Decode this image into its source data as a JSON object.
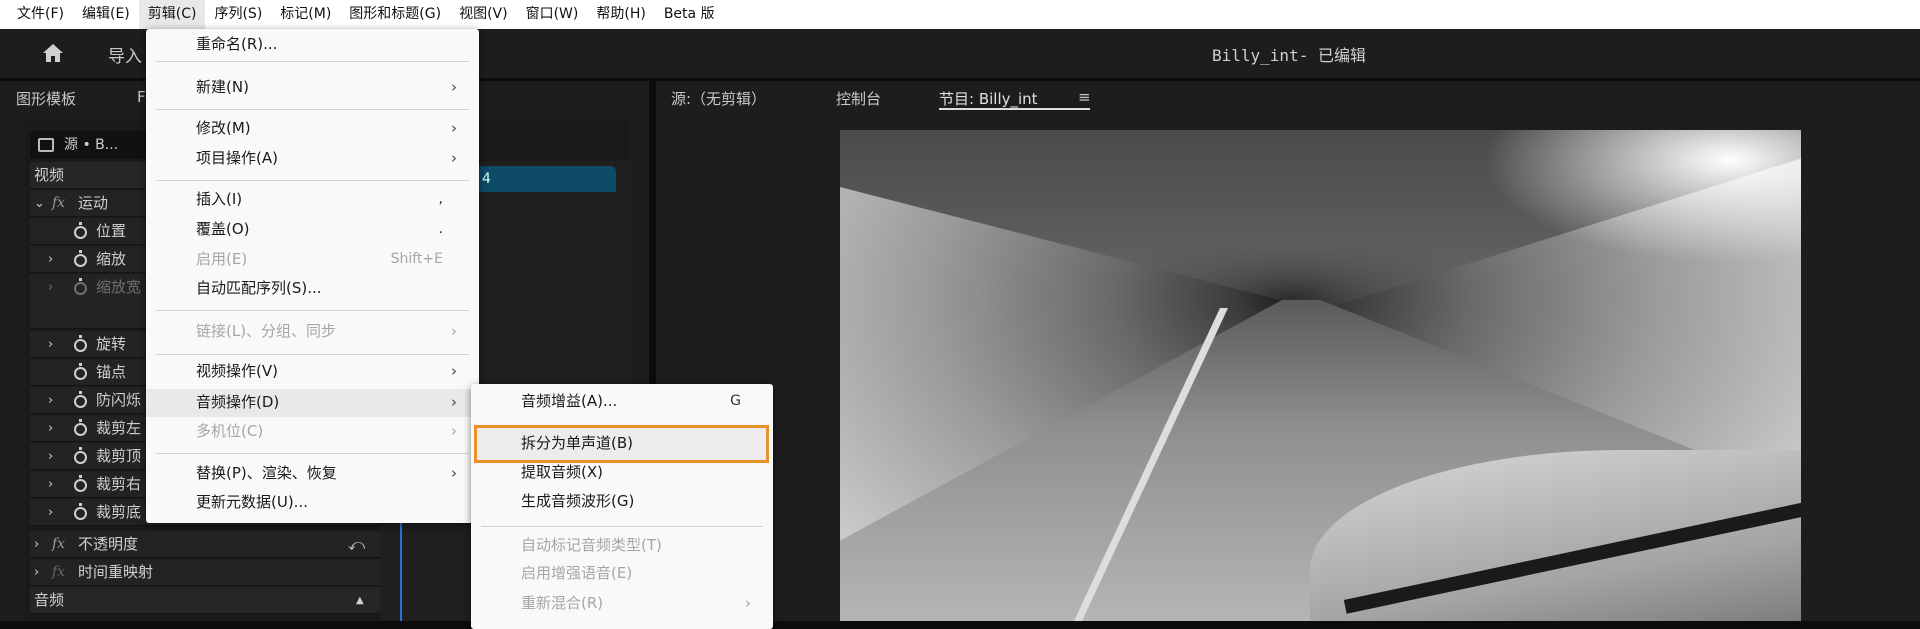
{
  "menubar": [
    "文件(F)",
    "编辑(E)",
    "剪辑(C)",
    "序列(S)",
    "标记(M)",
    "图形和标题(G)",
    "视图(V)",
    "窗口(W)",
    "帮助(H)",
    "Beta 版"
  ],
  "header": {
    "import_label": "导入",
    "title": "Billy_int- 已编辑"
  },
  "left_panel": {
    "tabs": [
      "图形模板",
      "F"
    ],
    "source_dropdown": "源 • B...",
    "clip_label": "4",
    "rows": {
      "video": "视频",
      "motion": "运动",
      "position": "位置",
      "scale": "缩放",
      "scale_width": "缩放宽",
      "rotation": "旋转",
      "anchor": "锚点",
      "anti_flicker": "防闪烁",
      "crop_left": "裁剪左",
      "crop_top": "裁剪顶",
      "crop_right": "裁剪右",
      "crop_bottom": "裁剪底",
      "opacity": "不透明度",
      "time_remap": "时间重映射",
      "audio": "音频"
    }
  },
  "right_panel": {
    "tabs": [
      "源:（无剪辑）",
      "控制台",
      "节目: Billy_int"
    ],
    "tab_menu_icon": "≡"
  },
  "clip_menu": {
    "items": [
      {
        "label": "重命名(R)..."
      },
      {
        "label": "新建(N)",
        "arrow": "›"
      },
      {
        "label": "修改(M)",
        "arrow": "›"
      },
      {
        "label": "项目操作(A)",
        "arrow": "›"
      },
      {
        "label": "插入(I)",
        "shortcut": ","
      },
      {
        "label": "覆盖(O)",
        "shortcut": "."
      },
      {
        "label": "启用(E)",
        "shortcut": "Shift+E"
      },
      {
        "label": "自动匹配序列(S)..."
      },
      {
        "label": "链接(L)、分组、同步",
        "arrow": "›"
      },
      {
        "label": "视频操作(V)",
        "arrow": "›"
      },
      {
        "label": "音频操作(D)",
        "arrow": "›"
      },
      {
        "label": "多机位(C)",
        "arrow": "›"
      },
      {
        "label": "替换(P)、渲染、恢复",
        "arrow": "›"
      },
      {
        "label": "更新元数据(U)..."
      }
    ]
  },
  "audio_submenu": {
    "items": [
      {
        "label": "音频增益(A)...",
        "shortcut": "G"
      },
      {
        "label": "拆分为单声道(B)"
      },
      {
        "label": "提取音频(X)"
      },
      {
        "label": "生成音频波形(G)"
      },
      {
        "label": "自动标记音频类型(T)"
      },
      {
        "label": "启用增强语音(E)"
      },
      {
        "label": "重新混合(R)",
        "arrow": "›"
      }
    ]
  },
  "colors": {
    "highlight_border": "#e8912d",
    "clip": "#0c4a66",
    "playhead": "#2d6fd6"
  }
}
